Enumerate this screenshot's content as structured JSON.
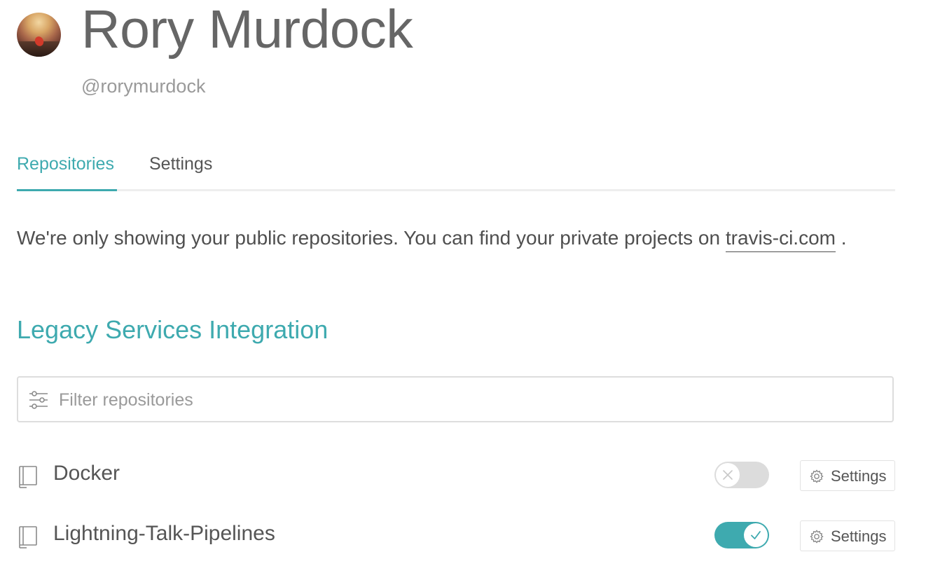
{
  "profile": {
    "name": "Rory Murdock",
    "handle": "@rorymurdock"
  },
  "tabs": [
    {
      "label": "Repositories",
      "active": true
    },
    {
      "label": "Settings",
      "active": false
    }
  ],
  "notice": {
    "text": "We're only showing your public repositories. You can find your private projects on",
    "link": "travis-ci.com",
    "suffix": "."
  },
  "section": {
    "title": "Legacy Services Integration"
  },
  "filter": {
    "placeholder": "Filter repositories",
    "value": ""
  },
  "repositories": [
    {
      "name": "Docker",
      "enabled": false,
      "settings_label": "Settings"
    },
    {
      "name": "Lightning-Talk-Pipelines",
      "enabled": true,
      "settings_label": "Settings"
    }
  ],
  "colors": {
    "accent": "#3eaaaf",
    "toggle_off": "#dcdcdc",
    "text": "#555555"
  },
  "icons": {
    "filter": "sliders-icon",
    "repo": "repo-book-icon",
    "settings": "gear-icon",
    "toggle_off": "close-icon",
    "toggle_on": "check-icon"
  }
}
